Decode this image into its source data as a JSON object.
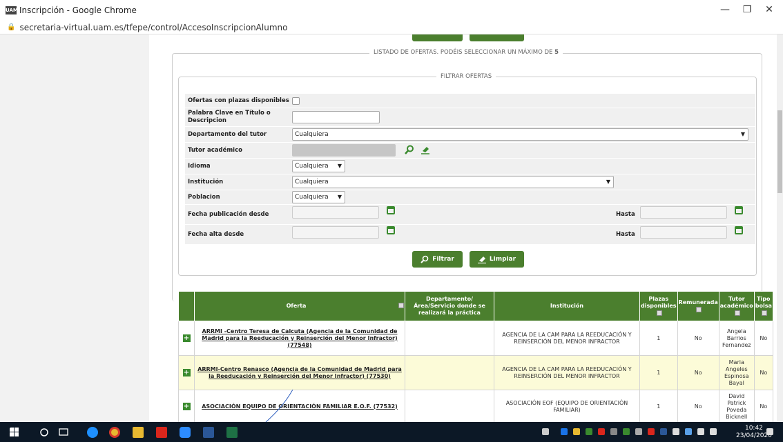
{
  "window": {
    "title": "Inscripción - Google Chrome",
    "logo_text": "UAM",
    "minimize": "—",
    "restore": "❐",
    "close": "✕"
  },
  "address": {
    "url": "secretaria-virtual.uam.es/tfepe/control/AccesoInscripcionAlumno"
  },
  "listado": {
    "title_prefix": "LISTADO DE OFERTAS. PODÉIS SELECCIONAR UN MÁXIMO DE ",
    "max": "5"
  },
  "filtro": {
    "title": "FILTRAR OFERTAS",
    "plazas_label": "Ofertas con plazas disponibles",
    "palabra_label": "Palabra Clave en Título o Descripcion",
    "palabra_value": "",
    "departamento_label": "Departamento del tutor",
    "departamento_value": "Cualquiera",
    "tutor_label": "Tutor académico",
    "idioma_label": "Idioma",
    "idioma_value": "Cualquiera",
    "institucion_label": "Institución",
    "institucion_value": "Cualquiera",
    "poblacion_label": "Poblacion",
    "poblacion_value": "Cualquiera",
    "fecha_pub_label": "Fecha publicación desde",
    "fecha_alta_label": "Fecha alta desde",
    "hasta_label": "Hasta",
    "filtrar_button": "Filtrar",
    "limpiar_button": "Limpiar"
  },
  "table": {
    "headers": {
      "oferta": "Oferta",
      "departamento": "Departamento/Área/Servicio donde se realizará la práctica",
      "institucion": "Institución",
      "plazas": "Plazas disponibles",
      "remunerada": "Remunerada",
      "tutor": "Tutor académico",
      "tipo": "Tipo bolsa"
    },
    "rows": [
      {
        "oferta": "ARRMI -Centro Teresa de Calcuta (Agencia de la Comunidad de Madrid para la Reeducación y Reinserción del Menor Infractor) (77548)",
        "departamento": "",
        "institucion": "AGENCIA DE LA CAM PARA LA REEDUCACIÓN Y REINSERCIÓN DEL MENOR INFRACTOR",
        "plazas": "1",
        "remunerada": "No",
        "tutor": "Angela Barrios Fernandez",
        "tipo": "No"
      },
      {
        "oferta": "ARRMI-Centro Renasco (Agencia de la Comunidad de Madrid para la Reeducación y Reinserción del Menor Infractor) (77530)",
        "departamento": "",
        "institucion": "AGENCIA DE LA CAM PARA LA REEDUCACIÓN Y REINSERCIÓN DEL MENOR INFRACTOR",
        "plazas": "1",
        "remunerada": "No",
        "tutor": "Maria Angeles Espinosa Bayal",
        "tipo": "No"
      },
      {
        "oferta": "ASOCIACIÓN EQUIPO DE ORIENTACIÓN FAMILIAR E.O.F. (77532)",
        "departamento": "",
        "institucion": "ASOCIACIÓN EOF (EQUIPO DE ORIENTACIÓN FAMILIAR)",
        "plazas": "1",
        "remunerada": "No",
        "tutor": "David Patrick Poveda Bicknell",
        "tipo": "No"
      }
    ]
  },
  "taskbar": {
    "time": "10:42",
    "date": "23/04/2020"
  },
  "colors": {
    "accent": "#4b7f2e",
    "highlight_row": "#fcfbd8",
    "taskbar": "#0c1826"
  }
}
